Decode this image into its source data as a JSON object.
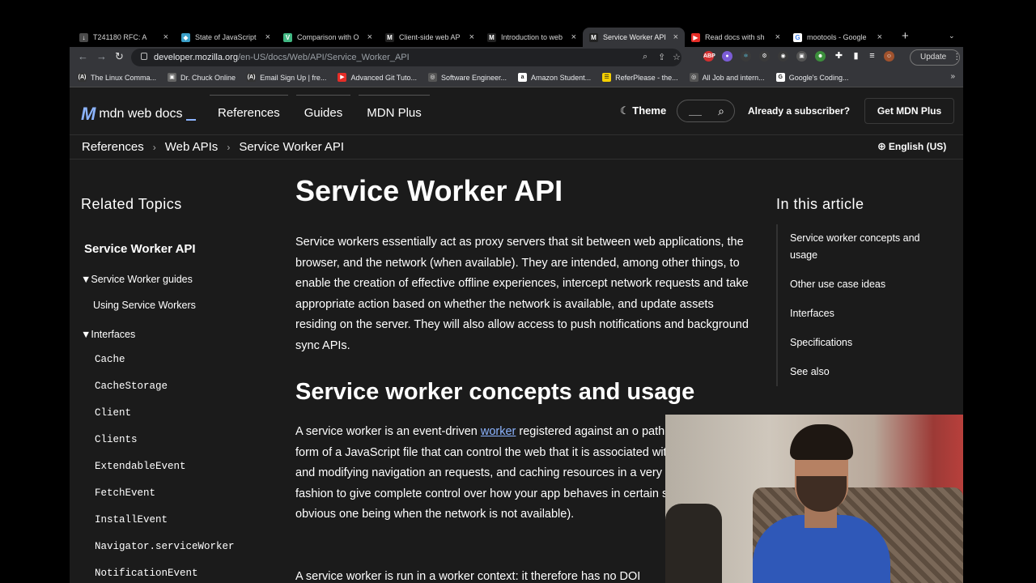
{
  "tabs": [
    {
      "label": "T241180 RFC: A",
      "fav": "↓",
      "fav_color": "#4a4a4a",
      "active": false
    },
    {
      "label": "State of JavaScript",
      "fav": "◆",
      "fav_color": "#3aa0c8",
      "active": false
    },
    {
      "label": "Comparison with O",
      "fav": "V",
      "fav_color": "#41b883",
      "active": false
    },
    {
      "label": "Client-side web AP",
      "fav": "M",
      "fav_color": "#222",
      "active": false
    },
    {
      "label": "Introduction to web",
      "fav": "M",
      "fav_color": "#222",
      "active": false
    },
    {
      "label": "Service Worker API",
      "fav": "M",
      "fav_color": "#222",
      "active": true
    },
    {
      "label": "Read docs with sh",
      "fav": "▶",
      "fav_color": "#e52d27",
      "active": false
    },
    {
      "label": "mootools - Google",
      "fav": "G",
      "fav_color": "#ffffff",
      "active": false
    }
  ],
  "toolbar": {
    "url_host": "developer.mozilla.org",
    "url_path": "/en-US/docs/Web/API/Service_Worker_API",
    "update_label": "Update"
  },
  "bookmarks": [
    {
      "label": "The Linux Comma...",
      "fav": "(A)",
      "color": "#333"
    },
    {
      "label": "Dr. Chuck Online",
      "fav": "▣",
      "color": "#666"
    },
    {
      "label": "Email Sign Up | fre...",
      "fav": "(A)",
      "color": "#333"
    },
    {
      "label": "Advanced Git Tuto...",
      "fav": "▶",
      "color": "#e52d27"
    },
    {
      "label": "Software Engineer...",
      "fav": "◎",
      "color": "#555"
    },
    {
      "label": "Amazon Student...",
      "fav": "a",
      "color": "#fff"
    },
    {
      "label": "ReferPlease - the...",
      "fav": "☰",
      "color": "#f5d000"
    },
    {
      "label": "All Job and intern...",
      "fav": "◎",
      "color": "#555"
    },
    {
      "label": "Google's Coding...",
      "fav": "G",
      "color": "#fff"
    }
  ],
  "header": {
    "logo_mark": "M",
    "logo_text": "mdn web docs",
    "nav": [
      "References",
      "Guides",
      "MDN Plus"
    ],
    "theme_label": "Theme",
    "subscriber_label": "Already a subscriber?",
    "get_plus_label": "Get MDN Plus"
  },
  "breadcrumb": [
    "References",
    "Web APIs",
    "Service Worker API"
  ],
  "language": "English (US)",
  "sidebar": {
    "heading": "Related Topics",
    "current": "Service Worker API",
    "guides_group": "Service Worker guides",
    "guides": [
      "Using Service Workers"
    ],
    "interfaces_group": "Interfaces",
    "interfaces": [
      "Cache",
      "CacheStorage",
      "Client",
      "Clients",
      "ExtendableEvent",
      "FetchEvent",
      "InstallEvent",
      "Navigator.serviceWorker",
      "NotificationEvent"
    ]
  },
  "main": {
    "title": "Service Worker API",
    "intro": "Service workers essentially act as proxy servers that sit between web applications, the browser, and the network (when available). They are intended, among other things, to enable the creation of effective offline experiences, intercept network requests and take appropriate action based on whether the network is available, and update assets residing on the server. They will also allow access to push notifications and background sync APIs.",
    "section_title": "Service worker concepts and usage",
    "para2_before": "A service worker is an event-driven ",
    "para2_link": "worker",
    "para2_after": " registered against an o path. It takes the form of a JavaScript file that can control the web that it is associated with, intercepting and modifying navigation an requests, and caching resources in a very granular fashion to give complete control over how your app behaves in certain situations obvious one being when the network is not available).",
    "para3": "A service worker is run in a worker context: it therefore has no DOI"
  },
  "toc": {
    "title": "In this article",
    "items": [
      "Service worker concepts and usage",
      "Other use case ideas",
      "Interfaces",
      "Specifications",
      "See also"
    ]
  }
}
